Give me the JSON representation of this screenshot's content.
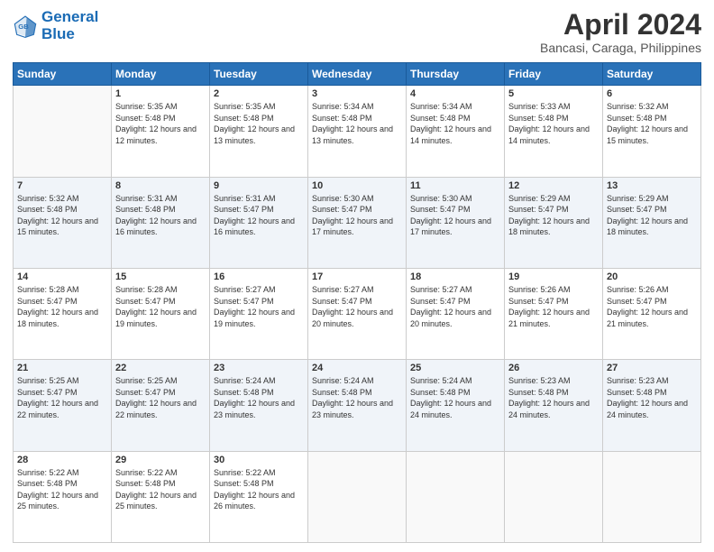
{
  "logo": {
    "line1": "General",
    "line2": "Blue"
  },
  "title": "April 2024",
  "subtitle": "Bancasi, Caraga, Philippines",
  "header_days": [
    "Sunday",
    "Monday",
    "Tuesday",
    "Wednesday",
    "Thursday",
    "Friday",
    "Saturday"
  ],
  "weeks": [
    [
      {
        "day": "",
        "sunrise": "",
        "sunset": "",
        "daylight": ""
      },
      {
        "day": "1",
        "sunrise": "Sunrise: 5:35 AM",
        "sunset": "Sunset: 5:48 PM",
        "daylight": "Daylight: 12 hours and 12 minutes."
      },
      {
        "day": "2",
        "sunrise": "Sunrise: 5:35 AM",
        "sunset": "Sunset: 5:48 PM",
        "daylight": "Daylight: 12 hours and 13 minutes."
      },
      {
        "day": "3",
        "sunrise": "Sunrise: 5:34 AM",
        "sunset": "Sunset: 5:48 PM",
        "daylight": "Daylight: 12 hours and 13 minutes."
      },
      {
        "day": "4",
        "sunrise": "Sunrise: 5:34 AM",
        "sunset": "Sunset: 5:48 PM",
        "daylight": "Daylight: 12 hours and 14 minutes."
      },
      {
        "day": "5",
        "sunrise": "Sunrise: 5:33 AM",
        "sunset": "Sunset: 5:48 PM",
        "daylight": "Daylight: 12 hours and 14 minutes."
      },
      {
        "day": "6",
        "sunrise": "Sunrise: 5:32 AM",
        "sunset": "Sunset: 5:48 PM",
        "daylight": "Daylight: 12 hours and 15 minutes."
      }
    ],
    [
      {
        "day": "7",
        "sunrise": "Sunrise: 5:32 AM",
        "sunset": "Sunset: 5:48 PM",
        "daylight": "Daylight: 12 hours and 15 minutes."
      },
      {
        "day": "8",
        "sunrise": "Sunrise: 5:31 AM",
        "sunset": "Sunset: 5:48 PM",
        "daylight": "Daylight: 12 hours and 16 minutes."
      },
      {
        "day": "9",
        "sunrise": "Sunrise: 5:31 AM",
        "sunset": "Sunset: 5:47 PM",
        "daylight": "Daylight: 12 hours and 16 minutes."
      },
      {
        "day": "10",
        "sunrise": "Sunrise: 5:30 AM",
        "sunset": "Sunset: 5:47 PM",
        "daylight": "Daylight: 12 hours and 17 minutes."
      },
      {
        "day": "11",
        "sunrise": "Sunrise: 5:30 AM",
        "sunset": "Sunset: 5:47 PM",
        "daylight": "Daylight: 12 hours and 17 minutes."
      },
      {
        "day": "12",
        "sunrise": "Sunrise: 5:29 AM",
        "sunset": "Sunset: 5:47 PM",
        "daylight": "Daylight: 12 hours and 18 minutes."
      },
      {
        "day": "13",
        "sunrise": "Sunrise: 5:29 AM",
        "sunset": "Sunset: 5:47 PM",
        "daylight": "Daylight: 12 hours and 18 minutes."
      }
    ],
    [
      {
        "day": "14",
        "sunrise": "Sunrise: 5:28 AM",
        "sunset": "Sunset: 5:47 PM",
        "daylight": "Daylight: 12 hours and 18 minutes."
      },
      {
        "day": "15",
        "sunrise": "Sunrise: 5:28 AM",
        "sunset": "Sunset: 5:47 PM",
        "daylight": "Daylight: 12 hours and 19 minutes."
      },
      {
        "day": "16",
        "sunrise": "Sunrise: 5:27 AM",
        "sunset": "Sunset: 5:47 PM",
        "daylight": "Daylight: 12 hours and 19 minutes."
      },
      {
        "day": "17",
        "sunrise": "Sunrise: 5:27 AM",
        "sunset": "Sunset: 5:47 PM",
        "daylight": "Daylight: 12 hours and 20 minutes."
      },
      {
        "day": "18",
        "sunrise": "Sunrise: 5:27 AM",
        "sunset": "Sunset: 5:47 PM",
        "daylight": "Daylight: 12 hours and 20 minutes."
      },
      {
        "day": "19",
        "sunrise": "Sunrise: 5:26 AM",
        "sunset": "Sunset: 5:47 PM",
        "daylight": "Daylight: 12 hours and 21 minutes."
      },
      {
        "day": "20",
        "sunrise": "Sunrise: 5:26 AM",
        "sunset": "Sunset: 5:47 PM",
        "daylight": "Daylight: 12 hours and 21 minutes."
      }
    ],
    [
      {
        "day": "21",
        "sunrise": "Sunrise: 5:25 AM",
        "sunset": "Sunset: 5:47 PM",
        "daylight": "Daylight: 12 hours and 22 minutes."
      },
      {
        "day": "22",
        "sunrise": "Sunrise: 5:25 AM",
        "sunset": "Sunset: 5:47 PM",
        "daylight": "Daylight: 12 hours and 22 minutes."
      },
      {
        "day": "23",
        "sunrise": "Sunrise: 5:24 AM",
        "sunset": "Sunset: 5:48 PM",
        "daylight": "Daylight: 12 hours and 23 minutes."
      },
      {
        "day": "24",
        "sunrise": "Sunrise: 5:24 AM",
        "sunset": "Sunset: 5:48 PM",
        "daylight": "Daylight: 12 hours and 23 minutes."
      },
      {
        "day": "25",
        "sunrise": "Sunrise: 5:24 AM",
        "sunset": "Sunset: 5:48 PM",
        "daylight": "Daylight: 12 hours and 24 minutes."
      },
      {
        "day": "26",
        "sunrise": "Sunrise: 5:23 AM",
        "sunset": "Sunset: 5:48 PM",
        "daylight": "Daylight: 12 hours and 24 minutes."
      },
      {
        "day": "27",
        "sunrise": "Sunrise: 5:23 AM",
        "sunset": "Sunset: 5:48 PM",
        "daylight": "Daylight: 12 hours and 24 minutes."
      }
    ],
    [
      {
        "day": "28",
        "sunrise": "Sunrise: 5:22 AM",
        "sunset": "Sunset: 5:48 PM",
        "daylight": "Daylight: 12 hours and 25 minutes."
      },
      {
        "day": "29",
        "sunrise": "Sunrise: 5:22 AM",
        "sunset": "Sunset: 5:48 PM",
        "daylight": "Daylight: 12 hours and 25 minutes."
      },
      {
        "day": "30",
        "sunrise": "Sunrise: 5:22 AM",
        "sunset": "Sunset: 5:48 PM",
        "daylight": "Daylight: 12 hours and 26 minutes."
      },
      {
        "day": "",
        "sunrise": "",
        "sunset": "",
        "daylight": ""
      },
      {
        "day": "",
        "sunrise": "",
        "sunset": "",
        "daylight": ""
      },
      {
        "day": "",
        "sunrise": "",
        "sunset": "",
        "daylight": ""
      },
      {
        "day": "",
        "sunrise": "",
        "sunset": "",
        "daylight": ""
      }
    ]
  ]
}
